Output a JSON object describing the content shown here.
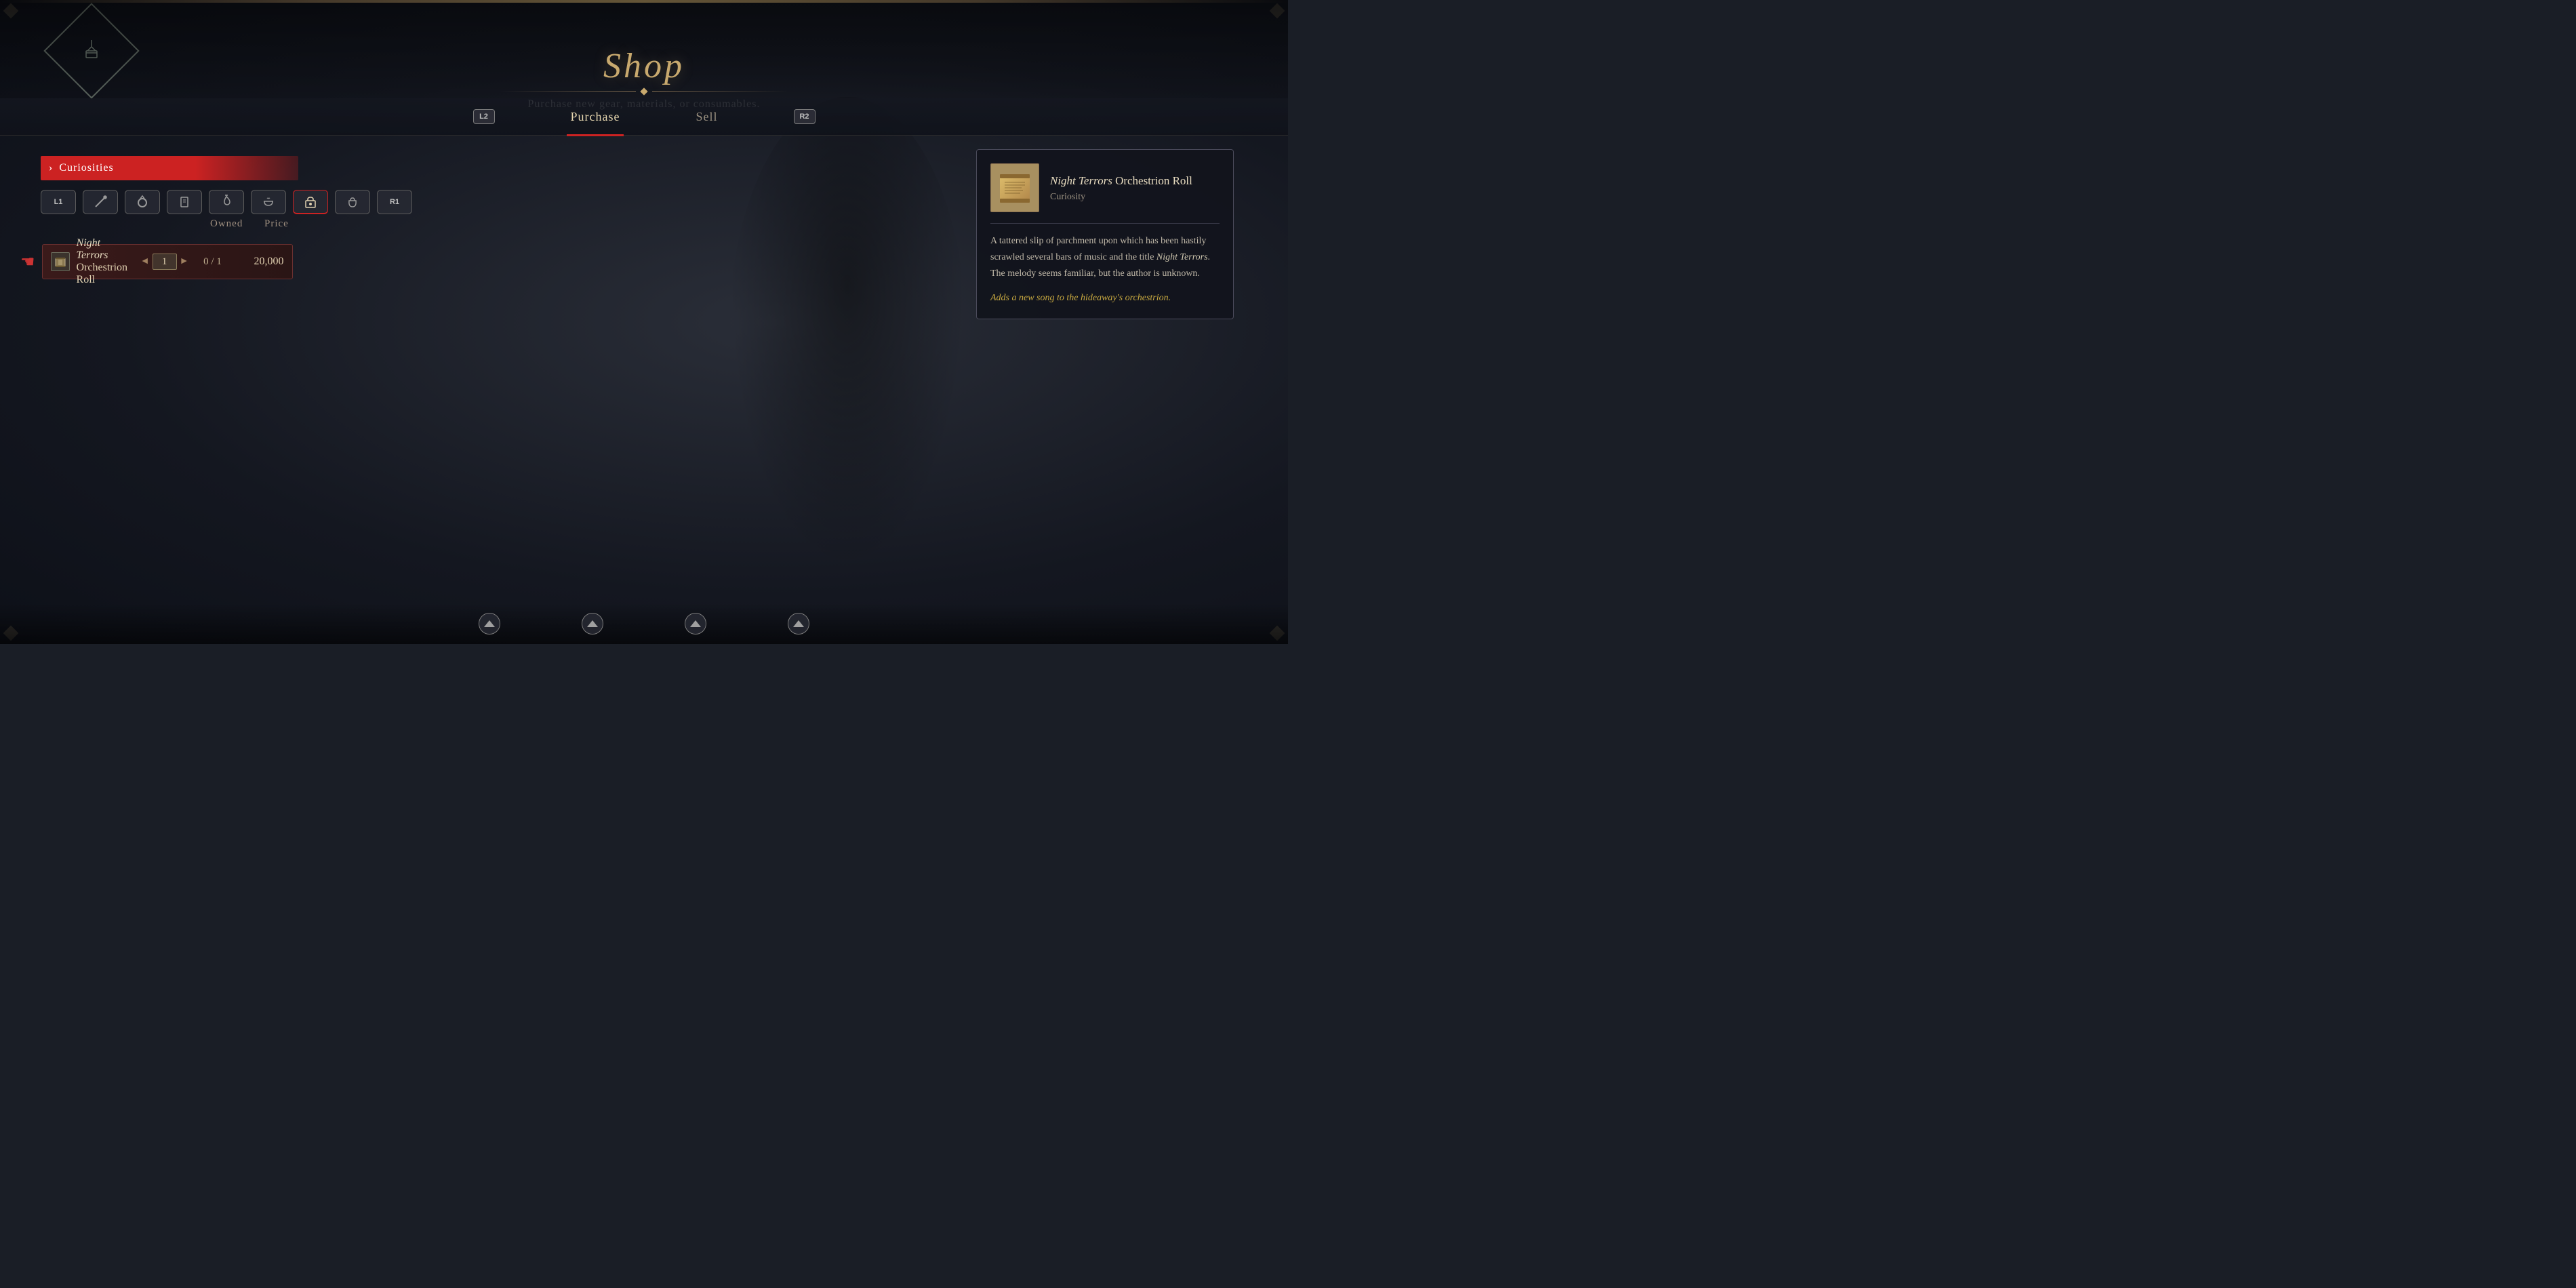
{
  "app": {
    "title": "Shop",
    "subtitle": "Purchase new gear, materials, or consumables.",
    "logo_text": "🏪"
  },
  "tabs": [
    {
      "id": "purchase",
      "label": "Purchase",
      "key": "L2",
      "active": true
    },
    {
      "id": "sell",
      "label": "Sell",
      "key": "R2",
      "active": false
    }
  ],
  "category": {
    "label": "Curiosities",
    "arrow": "›"
  },
  "icon_row": {
    "keys": [
      {
        "id": "l1",
        "label": "L1",
        "is_key": true
      },
      {
        "id": "wand",
        "symbol": "⚔",
        "title": "weapon"
      },
      {
        "id": "ring",
        "symbol": "⭕",
        "title": "ring"
      },
      {
        "id": "scroll2",
        "symbol": "📄",
        "title": "material"
      },
      {
        "id": "pendant",
        "symbol": "♦",
        "title": "pendant"
      },
      {
        "id": "bowl",
        "symbol": "🥣",
        "title": "consumable"
      },
      {
        "id": "chest",
        "symbol": "📦",
        "title": "key-item",
        "active": true
      },
      {
        "id": "bag",
        "symbol": "👜",
        "title": "bag"
      },
      {
        "id": "r1",
        "label": "R1",
        "is_key": true
      }
    ]
  },
  "columns": {
    "owned": "Owned",
    "price": "Price"
  },
  "item": {
    "name_italic": "Night Terrors",
    "name_rest": " Orchestrion Roll",
    "icon": "📜",
    "quantity": "1",
    "owned": "0 / 1",
    "price": "20,000"
  },
  "detail": {
    "item_name_italic": "Night Terrors",
    "item_name_rest": " Orchestrion Roll",
    "item_type": "Curiosity",
    "description_part1": "A tattered slip of parchment upon which has been hastily scrawled several bars of music and the title ",
    "description_italic": "Night Terrors",
    "description_part2": ". The melody seems familiar, but the author is unknown.",
    "effect": "Adds a new song to the hideaway's orchestrion."
  },
  "bottom_nav": {
    "buttons": [
      {
        "id": "btn1",
        "icon": "up"
      },
      {
        "id": "btn2",
        "icon": "up"
      },
      {
        "id": "btn3",
        "icon": "up"
      },
      {
        "id": "btn4",
        "icon": "up"
      }
    ]
  },
  "colors": {
    "accent": "#c8a96e",
    "red": "#cc2222",
    "dark_bg": "#141720",
    "panel_bg": "#12141c",
    "text_light": "#e8dcc0",
    "text_muted": "#9a9080",
    "effect_gold": "#c8a940"
  }
}
